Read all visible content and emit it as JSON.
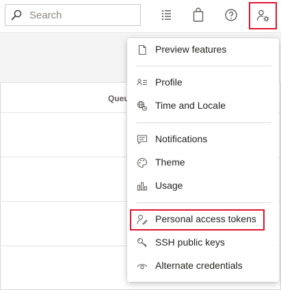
{
  "header": {
    "search_placeholder": "Search",
    "icons": [
      "search-icon",
      "list-icon",
      "shopping-bag-icon",
      "help-icon",
      "user-settings-icon"
    ]
  },
  "background": {
    "column_header": "Queu"
  },
  "menu": {
    "sections": [
      [
        {
          "label": "Preview features",
          "icon": "document-icon"
        }
      ],
      [
        {
          "label": "Profile",
          "icon": "profile-icon"
        },
        {
          "label": "Time and Locale",
          "icon": "globe-icon"
        }
      ],
      [
        {
          "label": "Notifications",
          "icon": "comment-icon"
        },
        {
          "label": "Theme",
          "icon": "palette-icon"
        },
        {
          "label": "Usage",
          "icon": "bar-chart-icon"
        }
      ],
      [
        {
          "label": "Personal access tokens",
          "icon": "token-icon"
        },
        {
          "label": "SSH public keys",
          "icon": "key-icon"
        },
        {
          "label": "Alternate credentials",
          "icon": "eye-icon"
        }
      ]
    ]
  },
  "colors": {
    "highlight": "#e0112b",
    "text": "#201f1e",
    "icon": "#605e5c"
  }
}
